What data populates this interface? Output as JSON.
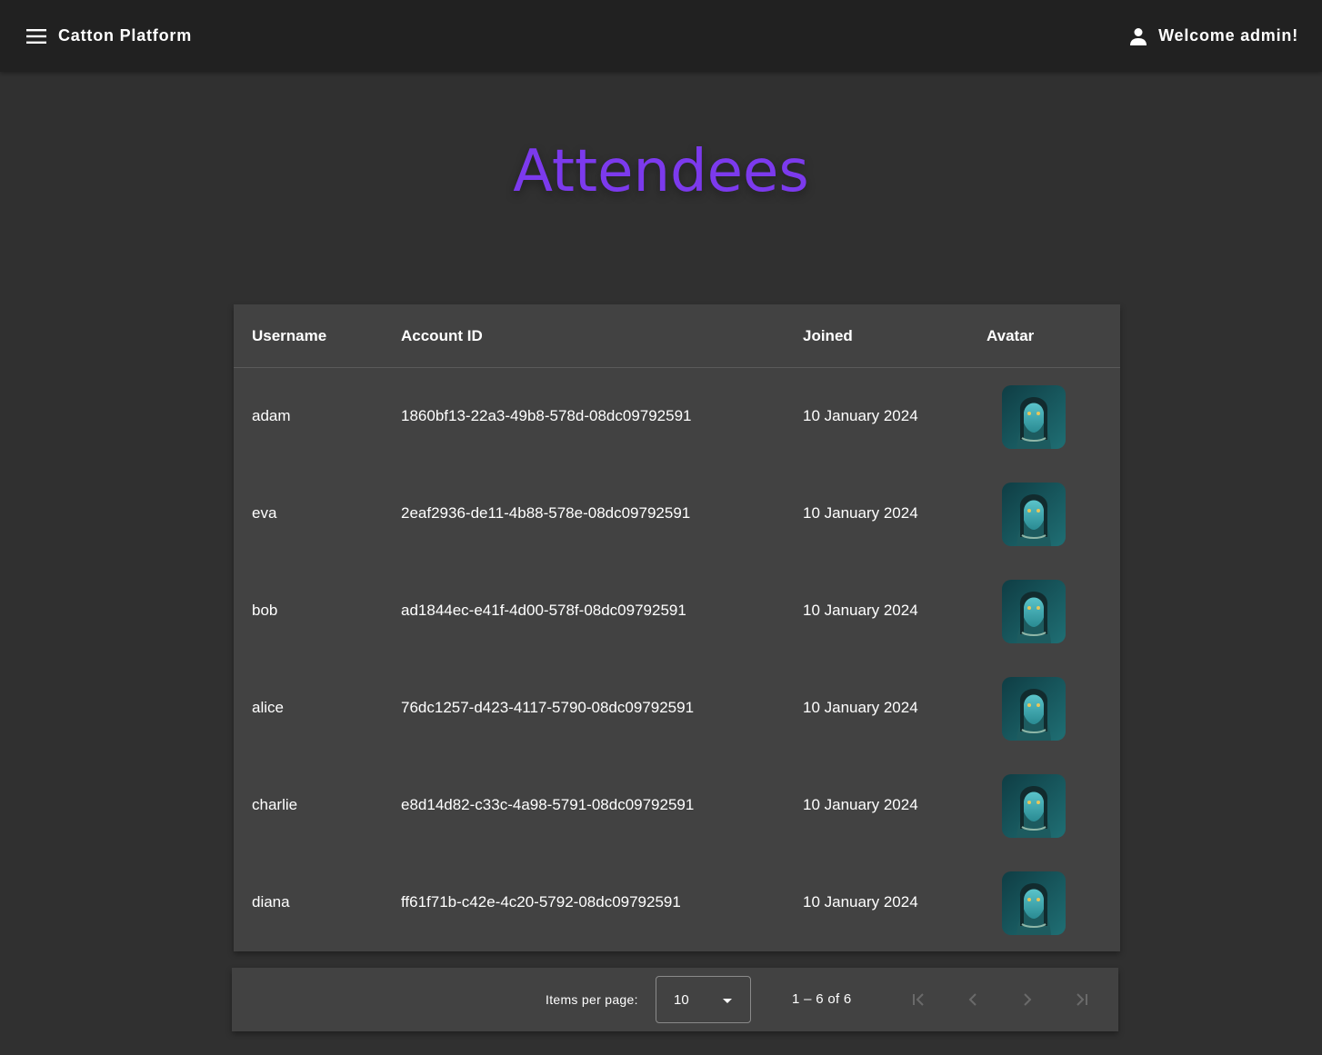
{
  "app": {
    "title": "Catton Platform",
    "welcome": "Welcome admin!"
  },
  "page": {
    "title": "Attendees"
  },
  "table": {
    "headers": [
      "Username",
      "Account ID",
      "Joined",
      "Avatar"
    ],
    "rows": [
      {
        "username": "adam",
        "account_id": "1860bf13-22a3-49b8-578d-08dc09792591",
        "joined": "10 January 2024"
      },
      {
        "username": "eva",
        "account_id": "2eaf2936-de11-4b88-578e-08dc09792591",
        "joined": "10 January 2024"
      },
      {
        "username": "bob",
        "account_id": "ad1844ec-e41f-4d00-578f-08dc09792591",
        "joined": "10 January 2024"
      },
      {
        "username": "alice",
        "account_id": "76dc1257-d423-4117-5790-08dc09792591",
        "joined": "10 January 2024"
      },
      {
        "username": "charlie",
        "account_id": "e8d14d82-c33c-4a98-5791-08dc09792591",
        "joined": "10 January 2024"
      },
      {
        "username": "diana",
        "account_id": "ff61f71b-c42e-4c20-5792-08dc09792591",
        "joined": "10 January 2024"
      }
    ]
  },
  "paginator": {
    "items_per_page_label": "Items per page:",
    "items_per_page_value": "10",
    "range_label": "1 – 6 of 6"
  },
  "icons": {
    "menu": "menu-icon",
    "user": "account-icon",
    "first": "first-page-icon",
    "prev": "chevron-left-icon",
    "next": "chevron-right-icon",
    "last": "last-page-icon"
  },
  "colors": {
    "accent": "#7c3aed",
    "toolbar": "#212121",
    "background": "#303030",
    "card": "#424242"
  }
}
